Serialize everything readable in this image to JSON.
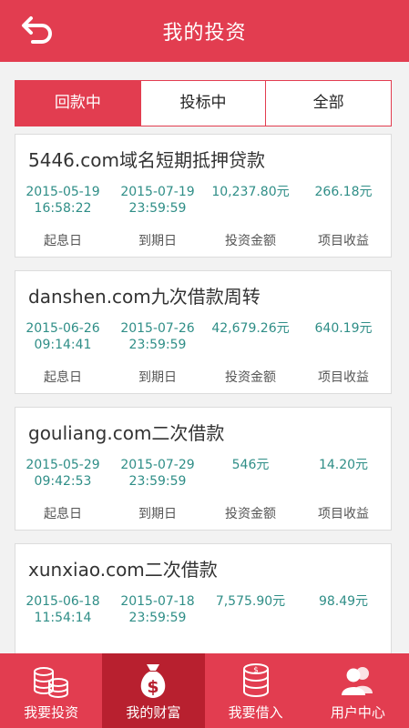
{
  "header": {
    "title": "我的投资"
  },
  "tabs": [
    {
      "label": "回款中",
      "active": true
    },
    {
      "label": "投标中",
      "active": false
    },
    {
      "label": "全部",
      "active": false
    }
  ],
  "column_labels": [
    "起息日",
    "到期日",
    "投资金额",
    "项目收益"
  ],
  "investments": [
    {
      "name": "5446.com域名短期抵押贷款",
      "start_date": "2015-05-19",
      "start_time": "16:58:22",
      "end_date": "2015-07-19",
      "end_time": "23:59:59",
      "amount": "10,237.80元",
      "profit": "266.18元"
    },
    {
      "name": "danshen.com九次借款周转",
      "start_date": "2015-06-26",
      "start_time": "09:14:41",
      "end_date": "2015-07-26",
      "end_time": "23:59:59",
      "amount": "42,679.26元",
      "profit": "640.19元"
    },
    {
      "name": "gouliang.com二次借款",
      "start_date": "2015-05-29",
      "start_time": "09:42:53",
      "end_date": "2015-07-29",
      "end_time": "23:59:59",
      "amount": "546元",
      "profit": "14.20元"
    },
    {
      "name": "xunxiao.com二次借款",
      "start_date": "2015-06-18",
      "start_time": "11:54:14",
      "end_date": "2015-07-18",
      "end_time": "23:59:59",
      "amount": "7,575.90元",
      "profit": "98.49元"
    }
  ],
  "bottom_nav": [
    {
      "label": "我要投资",
      "icon": "coins-icon",
      "active": false
    },
    {
      "label": "我的财富",
      "icon": "money-bag-icon",
      "active": true
    },
    {
      "label": "我要借入",
      "icon": "coin-stack-icon",
      "active": false
    },
    {
      "label": "用户中心",
      "icon": "users-icon",
      "active": false
    }
  ],
  "colors": {
    "primary": "#e23d50",
    "primary_dark": "#b8202f",
    "value_text": "#2f8e87"
  }
}
